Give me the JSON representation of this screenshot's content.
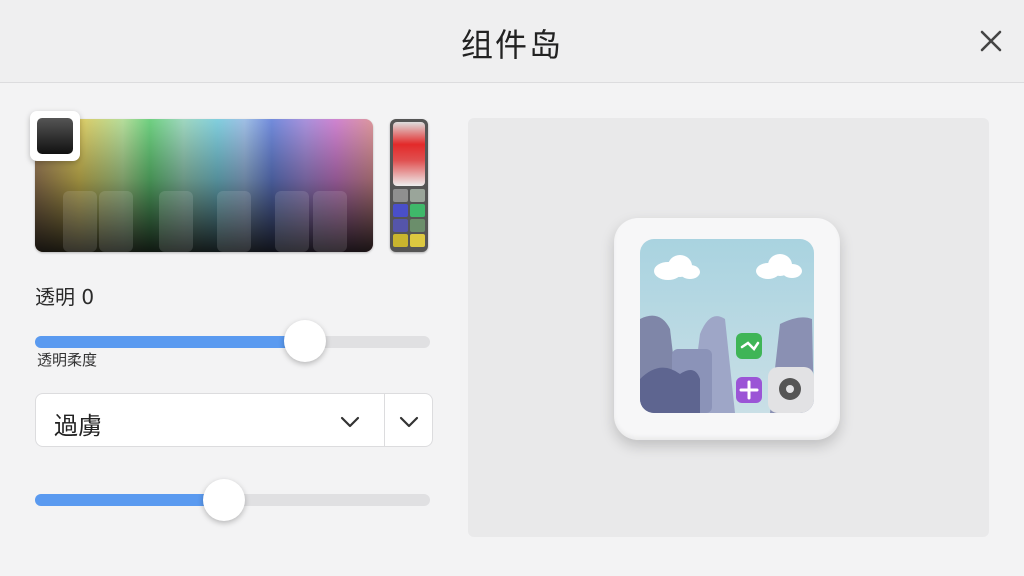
{
  "window": {
    "title": "组件岛"
  },
  "color": {
    "current_swatch": "#1a1a1a",
    "accent": "#5a9af0"
  },
  "opacity": {
    "label": "透明 0",
    "slider_value": 0.68,
    "slider_caption": "透明柔度"
  },
  "select": {
    "value": "過虜"
  },
  "second_slider": {
    "value": 0.48
  },
  "icons": {
    "close": "close-icon",
    "eyedropper": "eyedropper-icon",
    "dropdown": "chevron-down-icon",
    "settings": "gear-icon"
  }
}
